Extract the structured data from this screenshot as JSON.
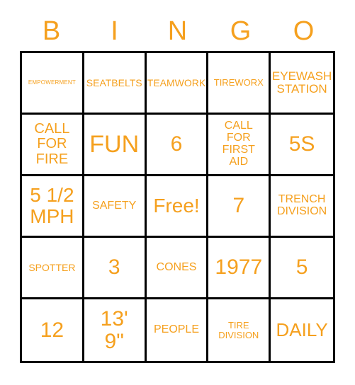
{
  "card": {
    "header": {
      "letters": [
        "B",
        "I",
        "N",
        "G",
        "O"
      ]
    },
    "accent_color": "#F5A01E",
    "border_color": "#000000",
    "background_color": "#FFFFFF",
    "rows": [
      [
        {
          "text": "EMPOWERMENT",
          "size": "s-xxs"
        },
        {
          "text": "SEATBELTS",
          "size": "s-sm"
        },
        {
          "text": "TEAMWORK",
          "size": "s-sm"
        },
        {
          "text": "TIREWORX",
          "size": "s-xs"
        },
        {
          "text": "EYEWASH\nSTATION",
          "size": "s-lg"
        }
      ],
      [
        {
          "text": "CALL\nFOR\nFIRE",
          "size": "s-xl"
        },
        {
          "text": "FUN",
          "size": "s-5xl"
        },
        {
          "text": "6",
          "size": "s-4xl"
        },
        {
          "text": "CALL\nFOR\nFIRST\nAID",
          "size": "s-md"
        },
        {
          "text": "5S",
          "size": "s-4xl"
        }
      ],
      [
        {
          "text": "5 1/2\nMPH",
          "size": "s-3xl"
        },
        {
          "text": "SAFETY",
          "size": "s-md"
        },
        {
          "text": "Free!",
          "size": "s-3xl"
        },
        {
          "text": "7",
          "size": "s-4xl"
        },
        {
          "text": "TRENCH\nDIVISION",
          "size": "s-md"
        }
      ],
      [
        {
          "text": "SPOTTER",
          "size": "s-sm"
        },
        {
          "text": "3",
          "size": "s-4xl"
        },
        {
          "text": "CONES",
          "size": "s-md"
        },
        {
          "text": "1977",
          "size": "s-4xl"
        },
        {
          "text": "5",
          "size": "s-4xl"
        }
      ],
      [
        {
          "text": "12",
          "size": "s-4xl"
        },
        {
          "text": "13'\n9\"",
          "size": "s-4xl"
        },
        {
          "text": "PEOPLE",
          "size": "s-md"
        },
        {
          "text": "TIRE\nDIVISION",
          "size": "s-xs"
        },
        {
          "text": "DAILY",
          "size": "s-2xl"
        }
      ]
    ],
    "free_space": {
      "row": 2,
      "col": 2,
      "label": "Free!"
    }
  }
}
